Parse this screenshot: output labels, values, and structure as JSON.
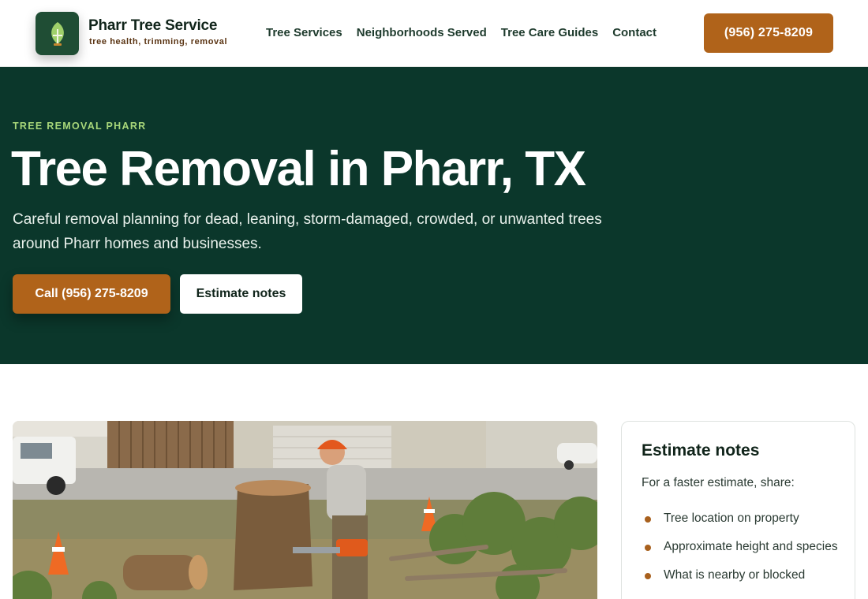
{
  "header": {
    "brand_name": "Pharr Tree Service",
    "brand_tagline": "tree health, trimming, removal",
    "logo_icon": "leaf-icon",
    "nav": [
      "Tree Services",
      "Neighborhoods Served",
      "Tree Care Guides",
      "Contact"
    ],
    "phone_label": "(956) 275-8209"
  },
  "hero": {
    "eyebrow": "TREE REMOVAL PHARR",
    "title": "Tree Removal in Pharr, TX",
    "subtitle": "Careful removal planning for dead, leaning, storm-damaged, crowded, or unwanted trees around Pharr homes and businesses.",
    "call_button": "Call (956) 275-8209",
    "notes_button": "Estimate notes"
  },
  "estimate_card": {
    "title": "Estimate notes",
    "intro": "For a faster estimate, share:",
    "items": [
      "Tree location on property",
      "Approximate height and species",
      "What is nearby or blocked"
    ]
  },
  "colors": {
    "hero_bg": "#0b372b",
    "accent": "#b0631a",
    "eyebrow": "#a8d77a",
    "logo_bg": "#1f4d34"
  }
}
